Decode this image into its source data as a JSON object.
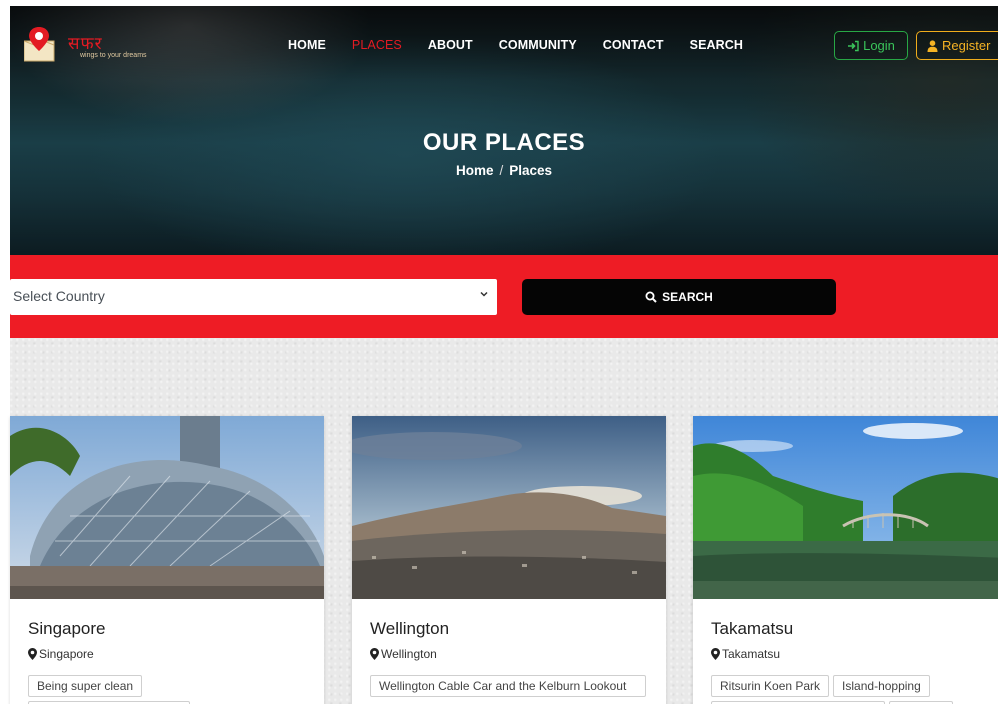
{
  "brand": {
    "logo_text": "सफर",
    "tagline": "wings to your dreams"
  },
  "nav": {
    "items": [
      {
        "label": "HOME",
        "active": false
      },
      {
        "label": "PLACES",
        "active": true
      },
      {
        "label": "ABOUT",
        "active": false
      },
      {
        "label": "COMMUNITY",
        "active": false
      },
      {
        "label": "CONTACT",
        "active": false
      },
      {
        "label": "SEARCH",
        "active": false
      }
    ],
    "login_label": "Login",
    "register_label": "Register",
    "login_icon": "sign-in-icon",
    "register_icon": "user-icon"
  },
  "hero": {
    "title": "OUR PLACES",
    "breadcrumb": [
      "Home",
      "Places"
    ],
    "separator": "/"
  },
  "search": {
    "select_value": "Select Country",
    "button_label": "SEARCH",
    "button_icon": "search-icon"
  },
  "cards": [
    {
      "title": "Singapore",
      "location": "Singapore",
      "tags": [
        "Being super clean",
        ""
      ]
    },
    {
      "title": "Wellington",
      "location": "Wellington",
      "tags": [
        "Wellington Cable Car and the Kelburn Lookout"
      ]
    },
    {
      "title": "Takamatsu",
      "location": "Takamatsu",
      "tags": [
        "Ritsurin Koen Park",
        "Island-hopping",
        "",
        ""
      ]
    }
  ],
  "colors": {
    "accent_red": "#ee1c25",
    "login_green": "#28a745",
    "register_orange": "#f0ad1c",
    "search_button": "#050505"
  }
}
